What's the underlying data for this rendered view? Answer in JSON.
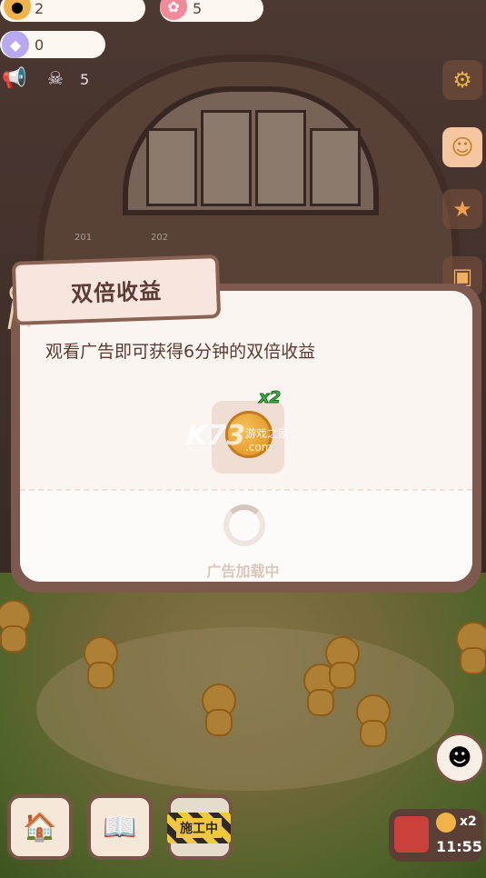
{
  "hud": {
    "cookies": "2",
    "gummies": "5",
    "gems": "0",
    "ghosts": "5"
  },
  "dialog": {
    "title": "双倍收益",
    "description": "观看广告即可获得6分钟的双倍收益",
    "reward_multiplier": "x2",
    "loading_text": "广告加载中"
  },
  "watermark": {
    "logo": "K73",
    "site": "游戏之家",
    "domain": ".com"
  },
  "bottom_bar": {
    "construction_label": "施工中",
    "boost_multiplier": "x2",
    "boost_timer": "11:55"
  },
  "building_rooms": [
    "201",
    "202"
  ],
  "colors": {
    "dialog_frame": "#7e5a4e",
    "dialog_bg": "#fbf5f1",
    "title_text": "#5b3b33",
    "x2_green": "#3bb54a"
  }
}
